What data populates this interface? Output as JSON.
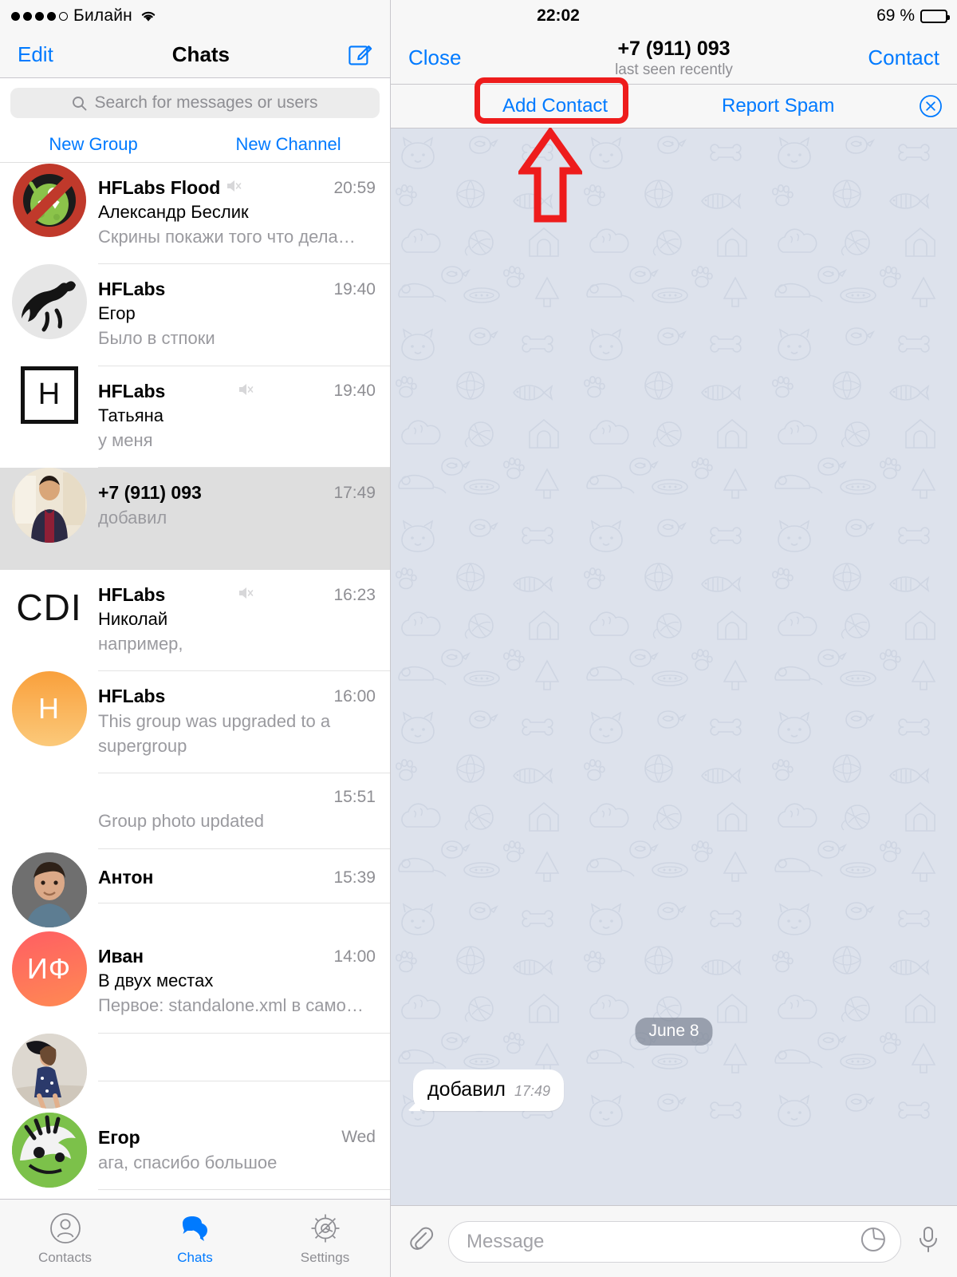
{
  "left_panel": {
    "status_bar": {
      "signal_dots_filled": 4,
      "signal_dots_total": 5,
      "carrier": "Билайн",
      "wifi_icon": "wifi-icon"
    },
    "navbar": {
      "edit_label": "Edit",
      "title": "Chats",
      "compose_icon": "compose-icon"
    },
    "search": {
      "placeholder": "Search for messages or users",
      "icon": "search-icon"
    },
    "quick_actions": {
      "new_group": "New Group",
      "new_channel": "New Channel"
    },
    "chats": [
      {
        "name": "HFLabs Flood",
        "sender": "Александр Беслик",
        "preview": "Скрины покажи того что дела…",
        "time": "20:59",
        "muted": true,
        "mute_pos": "inline",
        "avatar_type": "image-monster",
        "selected": false
      },
      {
        "name": "HFLabs",
        "sender": "Егор",
        "preview": "Было в стпоки",
        "time": "19:40",
        "muted": false,
        "avatar_type": "image-horse",
        "selected": false
      },
      {
        "name": "HFLabs",
        "sender": "Татьяна",
        "preview": "у меня",
        "time": "19:40",
        "muted": true,
        "mute_pos": "far",
        "avatar_type": "square-H",
        "avatar_letter": "H",
        "selected": false
      },
      {
        "name": "+7 (911) 093",
        "sender": "",
        "preview": "добавил",
        "time": "17:49",
        "muted": false,
        "avatar_type": "image-man",
        "selected": true
      },
      {
        "name": "HFLabs",
        "sender": "Николай",
        "preview": "например,",
        "time": "16:23",
        "muted": true,
        "mute_pos": "far",
        "avatar_type": "text-CDI",
        "avatar_letter": "CDI",
        "selected": false
      },
      {
        "name": "HFLabs",
        "sender": "",
        "preview": "This group was upgraded to a supergroup",
        "time": "16:00",
        "muted": false,
        "avatar_type": "initials-orange",
        "avatar_letter": "H",
        "selected": false
      },
      {
        "name": "",
        "sender": "",
        "preview": "Group photo updated",
        "time": "15:51",
        "muted": false,
        "avatar_type": "none",
        "selected": false
      },
      {
        "name": "Антон",
        "sender": "",
        "preview": "",
        "time": "15:39",
        "muted": false,
        "avatar_type": "image-man2",
        "selected": false
      },
      {
        "name": "Иван",
        "sender": "В двух местах",
        "preview": "Первое: standalone.xml в само…",
        "time": "14:00",
        "muted": false,
        "avatar_type": "initials-pink",
        "avatar_letter": "ИФ",
        "selected": false
      },
      {
        "name": "",
        "sender": "",
        "preview": "",
        "time": "",
        "muted": false,
        "avatar_type": "image-girl",
        "selected": false
      },
      {
        "name": "Егор",
        "sender": "",
        "preview": "ага, спасибо большое",
        "time": "Wed",
        "muted": false,
        "avatar_type": "image-green",
        "selected": false
      }
    ],
    "tabbar": [
      {
        "label": "Contacts",
        "icon": "contacts-icon",
        "active": false
      },
      {
        "label": "Chats",
        "icon": "chats-icon",
        "active": true
      },
      {
        "label": "Settings",
        "icon": "settings-gear-icon",
        "active": false
      }
    ]
  },
  "right_panel": {
    "status_bar": {
      "time": "22:02",
      "battery_percent": "69 %",
      "battery_level": 69,
      "battery_icon": "battery-icon"
    },
    "navbar": {
      "close_label": "Close",
      "title": "+7 (911) 093",
      "subtitle": "last seen recently",
      "contact_label": "Contact"
    },
    "action_bar": {
      "add_contact": "Add Contact",
      "report_spam": "Report Spam",
      "dismiss_icon": "close-circle-icon"
    },
    "conversation": {
      "date_badge": "June 8",
      "messages": [
        {
          "text": "добавил",
          "time": "17:49",
          "side": "incoming"
        }
      ]
    },
    "input_bar": {
      "attach_icon": "paperclip-icon",
      "placeholder": "Message",
      "sticker_icon": "sticker-icon",
      "mic_icon": "microphone-icon"
    }
  },
  "annotation": {
    "highlight_target": "Add Contact",
    "shapes": [
      "rounded-rect-outline",
      "up-arrow-outline"
    ],
    "color": "#ee1c1c"
  }
}
